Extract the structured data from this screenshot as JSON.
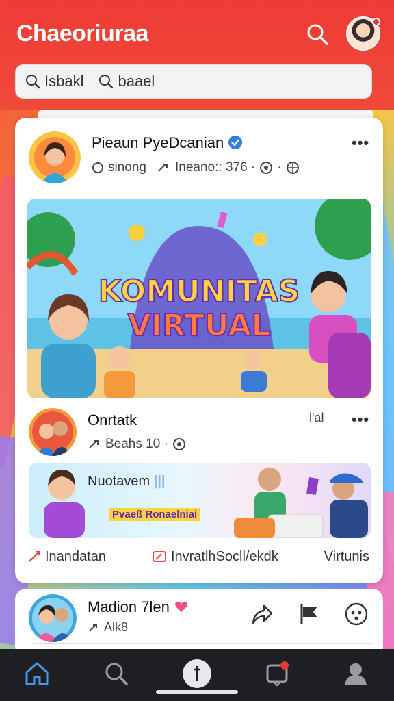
{
  "header": {
    "title": "Chaeoriuraa",
    "search_icon": "search-icon",
    "avatar_icon": "profile-avatar"
  },
  "search": {
    "segment1": "Isbakl",
    "segment2": "baael"
  },
  "post1": {
    "author": "Pieaun PyeDcanian",
    "meta_left": "sinong",
    "meta_right": "Ineano:: 376 ·"
  },
  "banner": {
    "line1": "KOMUNITAS",
    "line2": "VIRTUAL"
  },
  "post2": {
    "author": "Onrtatk",
    "meta": "Beahs 10 ·",
    "tag": "l'al",
    "banner_title": "Nuotavem",
    "banner_sub": "Pvaeß Ronaelniai"
  },
  "actions": {
    "action1": "Inandatan",
    "action2": "InvratlhSocll/ekdk",
    "action3": "Virtunis"
  },
  "post3": {
    "author": "Madion 7len",
    "meta": "Alk8"
  },
  "nav": {
    "items": [
      "home",
      "search",
      "create",
      "notifications",
      "profile"
    ]
  },
  "colors": {
    "header": "#ee3b36",
    "accent": "#2f7ddc",
    "nav_bg": "#1f1f23"
  }
}
